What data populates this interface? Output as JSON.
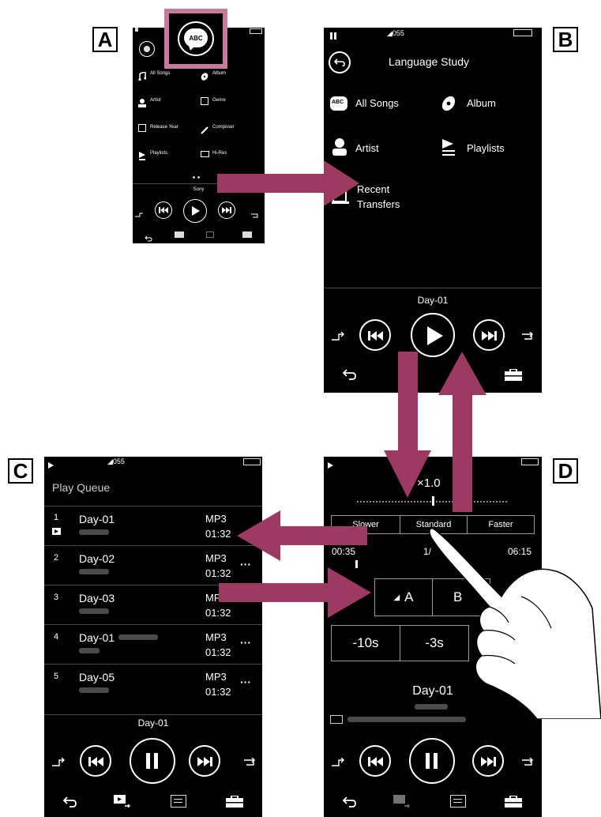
{
  "panels": {
    "a": {
      "tag": "A",
      "abc_icon_text": "ABC",
      "menu": [
        "All Songs",
        "Album",
        "Artist",
        "Genre",
        "Release Year",
        "Composer",
        "Playlists",
        "Hi-Res"
      ],
      "track": "Sony"
    },
    "b": {
      "tag": "B",
      "status_signal": "◢055",
      "title": "Language Study",
      "menu": [
        "All Songs",
        "Album",
        "Artist",
        "Playlists",
        "Recent",
        "Transfers"
      ],
      "track": "Day-01"
    },
    "c": {
      "tag": "C",
      "status_signal": "◢055",
      "title": "Play Queue",
      "rows": [
        {
          "num": "1",
          "title": "Day-01",
          "format": "MP3",
          "time": "01:32"
        },
        {
          "num": "2",
          "title": "Day-02",
          "format": "MP3",
          "time": "01:32"
        },
        {
          "num": "3",
          "title": "Day-03",
          "format": "MP3",
          "time": "01:32"
        },
        {
          "num": "4",
          "title": "Day-01",
          "format": "MP3",
          "time": "01:32"
        },
        {
          "num": "5",
          "title": "Day-05",
          "format": "MP3",
          "time": "01:32"
        }
      ],
      "track": "Day-01"
    },
    "d": {
      "tag": "D",
      "speed": "×1.0",
      "speed_buttons": [
        "Slower",
        "Standard",
        "Faster"
      ],
      "time_left": "00:35",
      "time_mid": "1/",
      "time_right": "06:15",
      "ab_a": "A",
      "ab_b": "B",
      "skip_1": "-10s",
      "skip_2": "-3s",
      "track": "Day-01"
    }
  },
  "colors": {
    "arrow": "#9c3a62",
    "highlight": "#c67a9c",
    "screen": "#000000"
  }
}
